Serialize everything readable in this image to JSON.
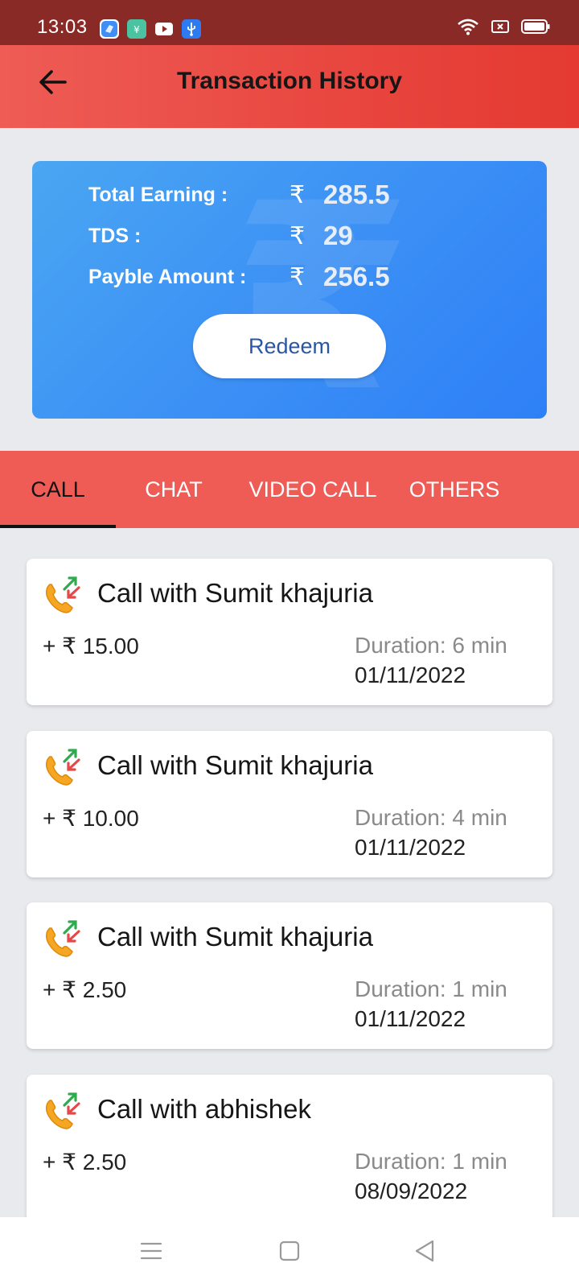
{
  "status_bar": {
    "time": "13:03",
    "app_icons": [
      {
        "name": "app-blue-icon",
        "color": "#3f8ef5"
      },
      {
        "name": "app-green-icon",
        "color": "#4cc3a0"
      },
      {
        "name": "youtube-icon",
        "color": "#ffffff"
      },
      {
        "name": "usb-icon",
        "color": "#2d7bf0"
      }
    ],
    "right_icons": [
      "wifi-icon",
      "sim-off-icon",
      "battery-icon"
    ]
  },
  "header": {
    "title": "Transaction History",
    "back_icon": "arrow-left-icon"
  },
  "summary": {
    "watermark": "₹",
    "rows": [
      {
        "label": "Total Earning :",
        "symbol": "₹",
        "value": "285.5"
      },
      {
        "label": "TDS :",
        "symbol": "₹",
        "value": "29"
      },
      {
        "label": "Payble Amount :",
        "symbol": "₹",
        "value": "256.5"
      }
    ],
    "redeem_label": "Redeem"
  },
  "tabs": [
    {
      "label": "CALL",
      "active": true
    },
    {
      "label": "CHAT",
      "active": false
    },
    {
      "label": "VIDEO CALL",
      "active": false
    },
    {
      "label": "OTHERS",
      "active": false
    }
  ],
  "transactions": [
    {
      "title": "Call with Sumit khajuria",
      "amount": "+ ₹ 15.00",
      "duration": "Duration: 6 min",
      "date": "01/11/2022"
    },
    {
      "title": "Call with Sumit khajuria",
      "amount": "+ ₹ 10.00",
      "duration": "Duration: 4 min",
      "date": "01/11/2022"
    },
    {
      "title": "Call with Sumit khajuria",
      "amount": "+ ₹ 2.50",
      "duration": "Duration: 1 min",
      "date": "01/11/2022"
    },
    {
      "title": "Call with abhishek",
      "amount": "+ ₹ 2.50",
      "duration": "Duration: 1 min",
      "date": "08/09/2022"
    }
  ],
  "nav": [
    "menu-icon",
    "home-square-icon",
    "back-triangle-icon"
  ],
  "colors": {
    "status_bar": "#8a2a26",
    "app_bar": "#e8463f",
    "tab_bar": "#ee5c55",
    "card_blue": "#3b8ff5",
    "redeem_text": "#2a56a5",
    "phone_orange": "#f5a623",
    "arrow_green": "#2faa4f",
    "arrow_red": "#e54848"
  }
}
